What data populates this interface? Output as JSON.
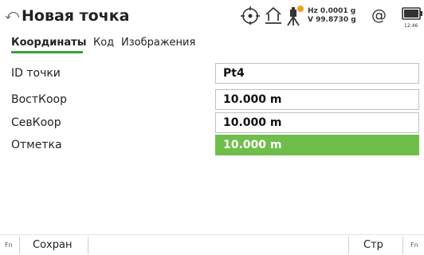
{
  "header": {
    "back_glyph": "⤺",
    "title": "Новая точка",
    "hz": "Hz 0.0001 g",
    "v": "V  99.8730 g",
    "at_glyph": "@",
    "time": "12:46",
    "icons": [
      "back-icon",
      "target-crosshair-icon",
      "home-base-icon",
      "instrument-signal-icon",
      "connection-at-icon",
      "battery-icon"
    ],
    "status_color": "#f0a020"
  },
  "tabs": {
    "items": [
      {
        "label": "Координаты",
        "active": true
      },
      {
        "label": "Код",
        "active": false
      },
      {
        "label": "Изображения",
        "active": false
      }
    ],
    "accent": "#3a9f3a"
  },
  "form": {
    "fields": [
      {
        "label": "ID точки",
        "value": "Pt4",
        "active": false
      },
      {
        "label": "ВостКоор",
        "value": "10.000 m",
        "active": false
      },
      {
        "label": "СевКоор",
        "value": "10.000 m",
        "active": false
      },
      {
        "label": "Отметка",
        "value": "10.000 m",
        "active": true
      }
    ],
    "active_color": "#6fbe4c"
  },
  "footer": {
    "fn_left": "Fn",
    "fn_right": "Fn",
    "save_label": "Сохран",
    "page_label": "Стр"
  }
}
